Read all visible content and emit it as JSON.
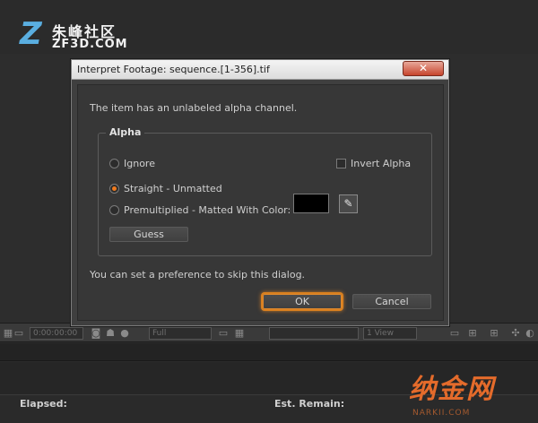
{
  "logo": {
    "cn": "朱峰社区",
    "en": "ZF3D.COM",
    "mark": "Z"
  },
  "watermark": {
    "cn": "纳金网",
    "en": "NARKII.COM"
  },
  "background": {
    "timecode": "0:00:00:00",
    "quality": "Full",
    "view": "1 View",
    "elapsed_label": "Elapsed:",
    "remain_label": "Est. Remain:"
  },
  "dialog": {
    "title": "Interpret Footage: sequence.[1-356].tif",
    "close_glyph": "✕",
    "message": "The item has an unlabeled alpha channel.",
    "group_title": "Alpha",
    "options": {
      "ignore": "Ignore",
      "straight": "Straight - Unmatted",
      "premultiplied": "Premultiplied - Matted With Color:"
    },
    "selected_option": "straight",
    "invert_alpha": {
      "label": "Invert Alpha",
      "checked": false
    },
    "matte_color": "#000000",
    "guess_label": "Guess",
    "preference_note": "You can set a preference to skip this dialog.",
    "ok_label": "OK",
    "cancel_label": "Cancel"
  },
  "colors": {
    "accent": "#ef7a1e",
    "dialog_bg": "#3f3f3f",
    "close_red": "#c7452d"
  }
}
